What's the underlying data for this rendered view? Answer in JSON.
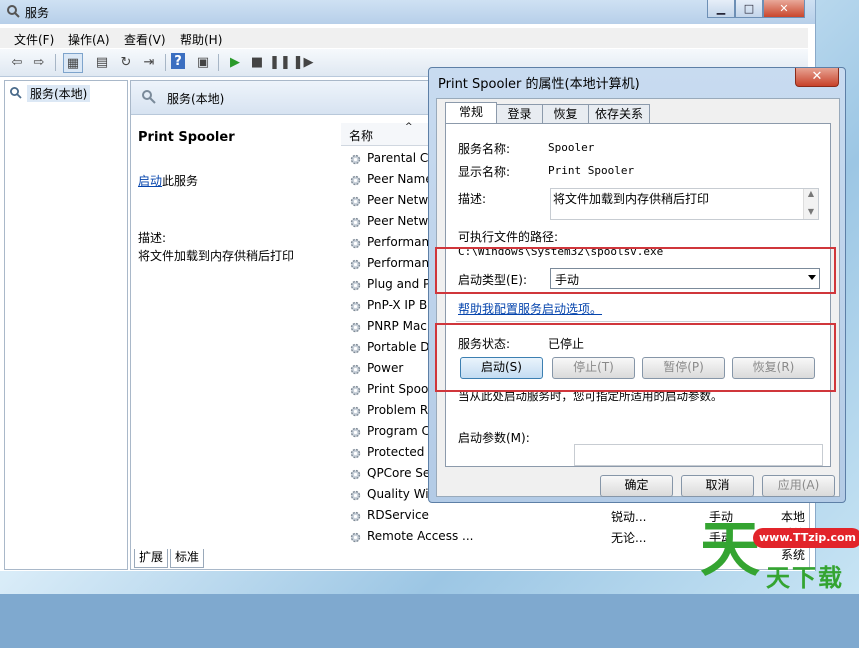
{
  "window": {
    "title": "服务",
    "controls": {
      "minimize": "▁",
      "maximize": "□",
      "close": "✕"
    }
  },
  "menu": [
    "文件(F)",
    "操作(A)",
    "查看(V)",
    "帮助(H)"
  ],
  "toolbar": [
    "back-icon",
    "forward-icon",
    "console-tree-icon",
    "properties-icon",
    "refresh-icon",
    "export-icon",
    "help-icon",
    "view-icon",
    "start-icon",
    "stop-icon",
    "pause-icon",
    "restart-icon"
  ],
  "tree": {
    "item": "服务(本地)"
  },
  "pane": {
    "header": "服务(本地)",
    "service_name": "Print Spooler",
    "start_link": "启动",
    "start_suffix": "此服务",
    "desc_label": "描述:",
    "desc_text": "将文件加载到内存供稍后打印",
    "column_name": "名称",
    "rows": [
      {
        "name": "Parental Co",
        "desc": "",
        "status": "",
        "startup": ""
      },
      {
        "name": "Peer Name",
        "desc": "",
        "status": "",
        "startup": ""
      },
      {
        "name": "Peer Netwo",
        "desc": "",
        "status": "",
        "startup": ""
      },
      {
        "name": "Peer Netwo",
        "desc": "",
        "status": "",
        "startup": ""
      },
      {
        "name": "Performan",
        "desc": "",
        "status": "",
        "startup": ""
      },
      {
        "name": "Performan",
        "desc": "",
        "status": "",
        "startup": ""
      },
      {
        "name": "Plug and P",
        "desc": "",
        "status": "",
        "startup": ""
      },
      {
        "name": "PnP-X IP B",
        "desc": "",
        "status": "",
        "startup": ""
      },
      {
        "name": "PNRP Mac",
        "desc": "",
        "status": "",
        "startup": ""
      },
      {
        "name": "Portable D",
        "desc": "",
        "status": "",
        "startup": ""
      },
      {
        "name": "Power",
        "desc": "",
        "status": "",
        "startup": ""
      },
      {
        "name": "Print Spoo",
        "desc": "",
        "status": "",
        "startup": ""
      },
      {
        "name": "Problem R",
        "desc": "",
        "status": "",
        "startup": ""
      },
      {
        "name": "Program C",
        "desc": "",
        "status": "",
        "startup": ""
      },
      {
        "name": "Protected",
        "desc": "",
        "status": "",
        "startup": ""
      },
      {
        "name": "QPCore Se",
        "desc": "",
        "status": "",
        "startup": ""
      },
      {
        "name": "Quality Wi",
        "desc": "",
        "status": "",
        "startup": ""
      },
      {
        "name": "RDService",
        "desc": "锐动...",
        "status": "手动",
        "startup": "本地系统"
      },
      {
        "name": "Remote Access ...",
        "desc": "无论...",
        "status": "手动",
        "startup": "本地系统"
      }
    ],
    "bottom_tabs": [
      "扩展",
      "标准"
    ]
  },
  "dialog": {
    "title": "Print Spooler 的属性(本地计算机)",
    "close": "✕",
    "tabs": [
      "常规",
      "登录",
      "恢复",
      "依存关系"
    ],
    "service_name_label": "服务名称:",
    "service_name_value": "Spooler",
    "display_name_label": "显示名称:",
    "display_name_value": "Print Spooler",
    "desc_label": "描述:",
    "desc_value": "将文件加载到内存供稍后打印",
    "path_label": "可执行文件的路径:",
    "path_value": "C:\\Windows\\System32\\spoolsv.exe",
    "startup_type_label": "启动类型(E):",
    "startup_type_value": "手动",
    "help_link": "帮助我配置服务启动选项。",
    "status_label": "服务状态:",
    "status_value": "已停止",
    "btn_start": "启动(S)",
    "btn_stop": "停止(T)",
    "btn_pause": "暂停(P)",
    "btn_resume": "恢复(R)",
    "hint": "当从此处启动服务时，您可指定所适用的启动参数。",
    "param_label": "启动参数(M):",
    "param_value": "",
    "btn_ok": "确定",
    "btn_cancel": "取消",
    "btn_apply": "应用(A)"
  },
  "watermark": {
    "url": "www.TTzip.com",
    "big": "天",
    "small": "天下载"
  },
  "colors": {
    "highlight_box": "#d0363b",
    "link": "#0645ad",
    "watermark_green": "#34a431",
    "watermark_red": "#e2242a"
  }
}
